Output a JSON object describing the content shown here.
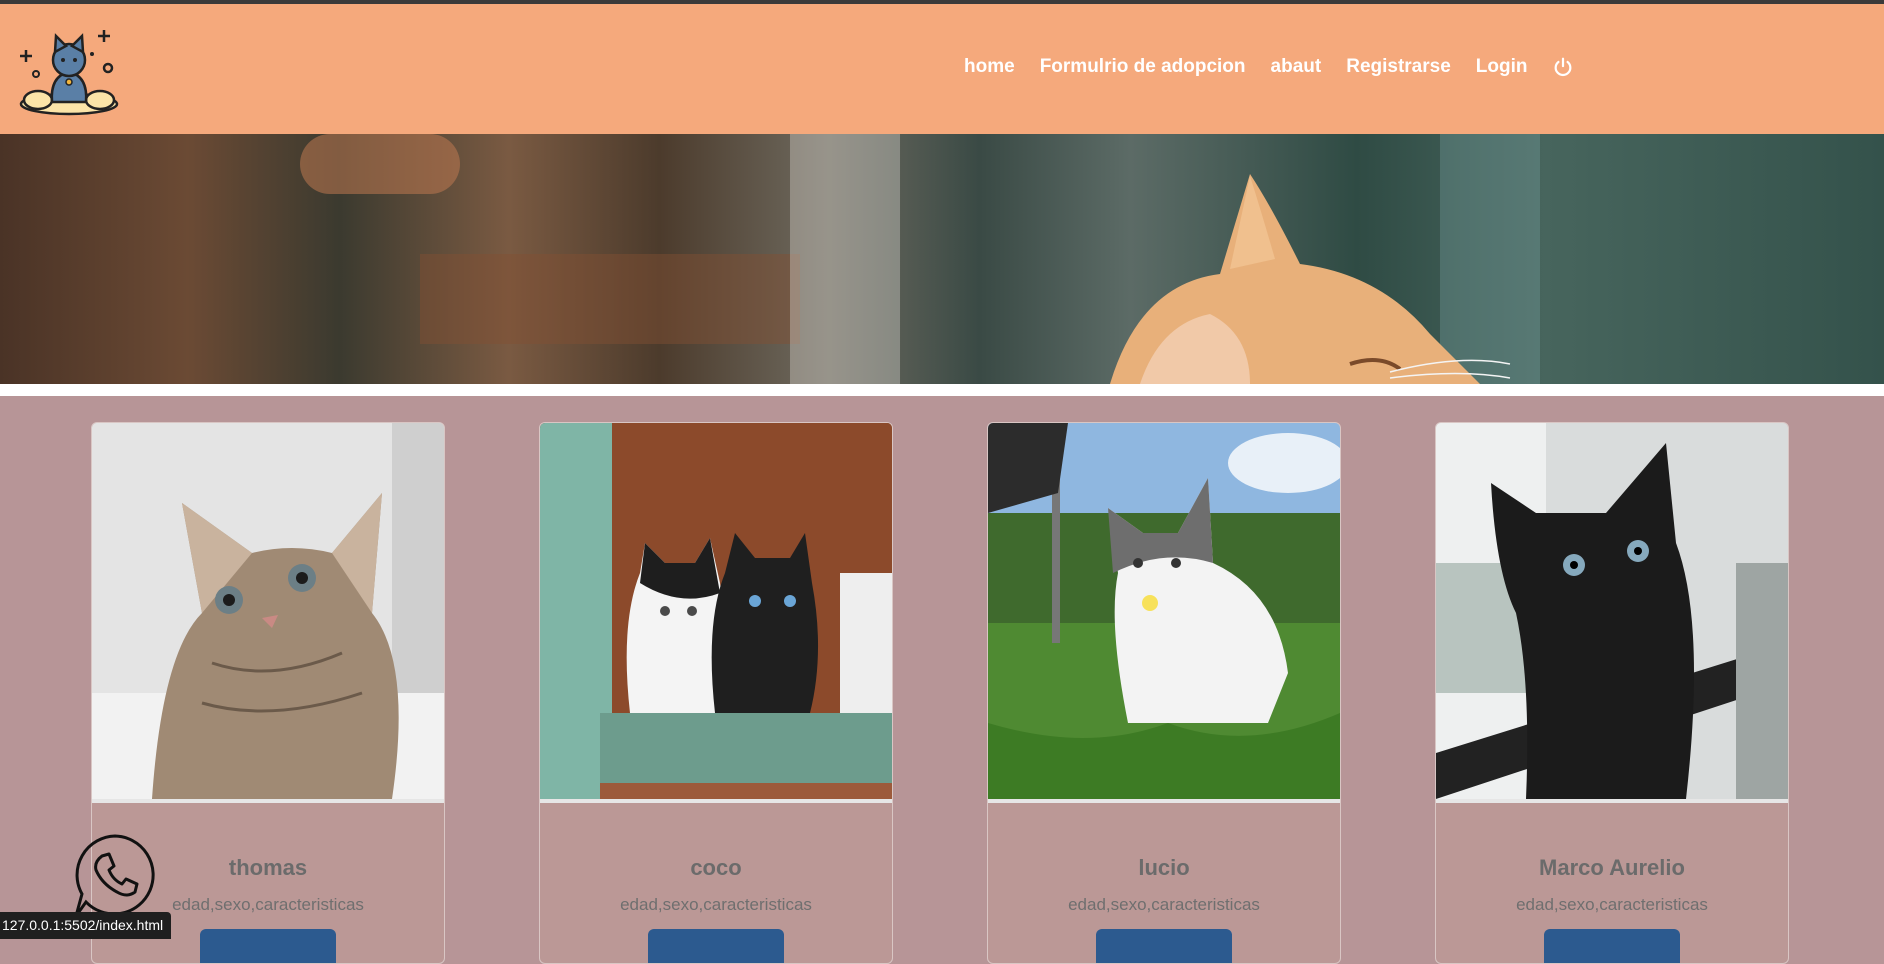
{
  "nav": {
    "links": [
      {
        "label": "home"
      },
      {
        "label": "Formulrio de adopcion"
      },
      {
        "label": "abaut"
      },
      {
        "label": "Registrarse"
      },
      {
        "label": "Login"
      }
    ],
    "logout_icon": "power-icon",
    "logo_icon": "cat-logo-icon"
  },
  "cards": [
    {
      "name": "thomas",
      "description": "edad,sexo,caracteristicas"
    },
    {
      "name": "coco",
      "description": "edad,sexo,caracteristicas"
    },
    {
      "name": "lucio",
      "description": "edad,sexo,caracteristicas"
    },
    {
      "name": "Marco Aurelio",
      "description": "edad,sexo,caracteristicas"
    }
  ],
  "floating": {
    "icon": "whatsapp-phone-icon"
  },
  "status_bar": {
    "url": "127.0.0.1:5502/index.html"
  },
  "colors": {
    "navbar": "#f5a97c",
    "page_background": "#b79597",
    "button": "#2c5a8f"
  }
}
